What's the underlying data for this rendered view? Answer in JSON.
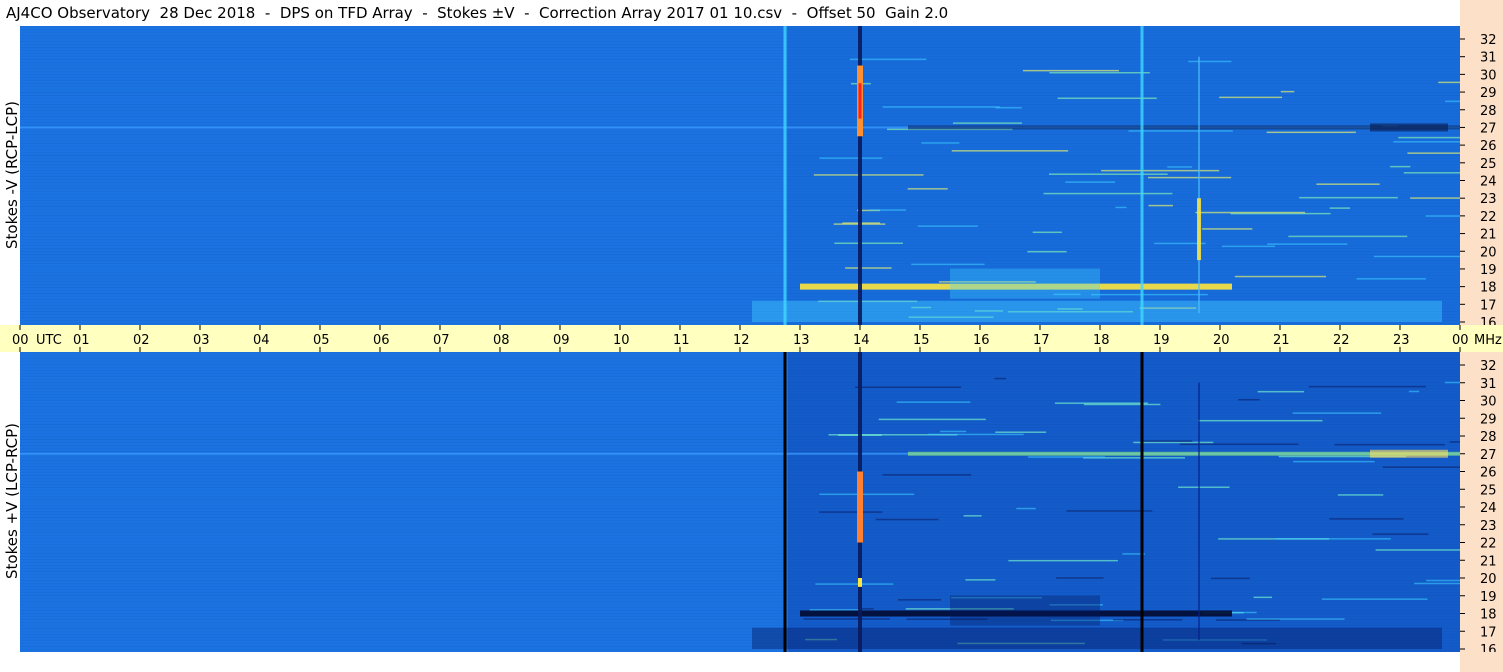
{
  "header": {
    "title": "AJ4CO Observatory  28 Dec 2018  -  DPS on TFD Array  -  Stokes ±V  -  Correction Array 2017 01 10.csv  -  Offset 50  Gain 2.0"
  },
  "chart_data": [
    {
      "type": "heatmap",
      "panel": "top",
      "ylabel": "Stokes -V (RCP-LCP)",
      "x_axis_unit": "UTC",
      "x_ticks": [
        "00",
        "01",
        "02",
        "03",
        "04",
        "05",
        "06",
        "07",
        "08",
        "09",
        "10",
        "11",
        "12",
        "13",
        "14",
        "15",
        "16",
        "17",
        "18",
        "19",
        "20",
        "21",
        "22",
        "23",
        "00"
      ],
      "xlim_hours": [
        0,
        24
      ],
      "y_axis_unit": "MHz",
      "y_ticks": [
        "16",
        "17",
        "18",
        "19",
        "20",
        "21",
        "22",
        "23",
        "24",
        "25",
        "26",
        "27",
        "28",
        "29",
        "30",
        "31",
        "32"
      ],
      "ylim_mhz": [
        16,
        32
      ],
      "features": {
        "vertical_bright_lines_hours": [
          12.75,
          18.7
        ],
        "burst_hour": 14.0,
        "persistent_band_mhz": 27,
        "strong_band_mhz": 18,
        "strong_band_hours": [
          13.0,
          20.2
        ],
        "narrow_vertical_hour": 19.65
      }
    },
    {
      "type": "heatmap",
      "panel": "bottom",
      "ylabel": "Stokes +V (LCP-RCP)",
      "x_axis_unit": "UTC",
      "x_ticks": [
        "00",
        "01",
        "02",
        "03",
        "04",
        "05",
        "06",
        "07",
        "08",
        "09",
        "10",
        "11",
        "12",
        "13",
        "14",
        "15",
        "16",
        "17",
        "18",
        "19",
        "20",
        "21",
        "22",
        "23",
        "00"
      ],
      "xlim_hours": [
        0,
        24
      ],
      "y_axis_unit": "MHz",
      "y_ticks": [
        "16",
        "17",
        "18",
        "19",
        "20",
        "21",
        "22",
        "23",
        "24",
        "25",
        "26",
        "27",
        "28",
        "29",
        "30",
        "31",
        "32"
      ],
      "ylim_mhz": [
        16,
        32
      ],
      "features": {
        "vertical_dark_lines_hours": [
          12.75,
          18.7
        ],
        "burst_hour": 14.0,
        "persistent_band_mhz": 27,
        "dark_band_mhz": 18,
        "dark_band_hours": [
          13.0,
          20.2
        ]
      }
    }
  ],
  "axis": {
    "utc_label": "UTC",
    "mhz_label": "MHz"
  },
  "colors": {
    "background_blue": "#1a73e0",
    "time_axis_bg": "#ffffc0",
    "right_strip_bg": "#fde0c8"
  }
}
